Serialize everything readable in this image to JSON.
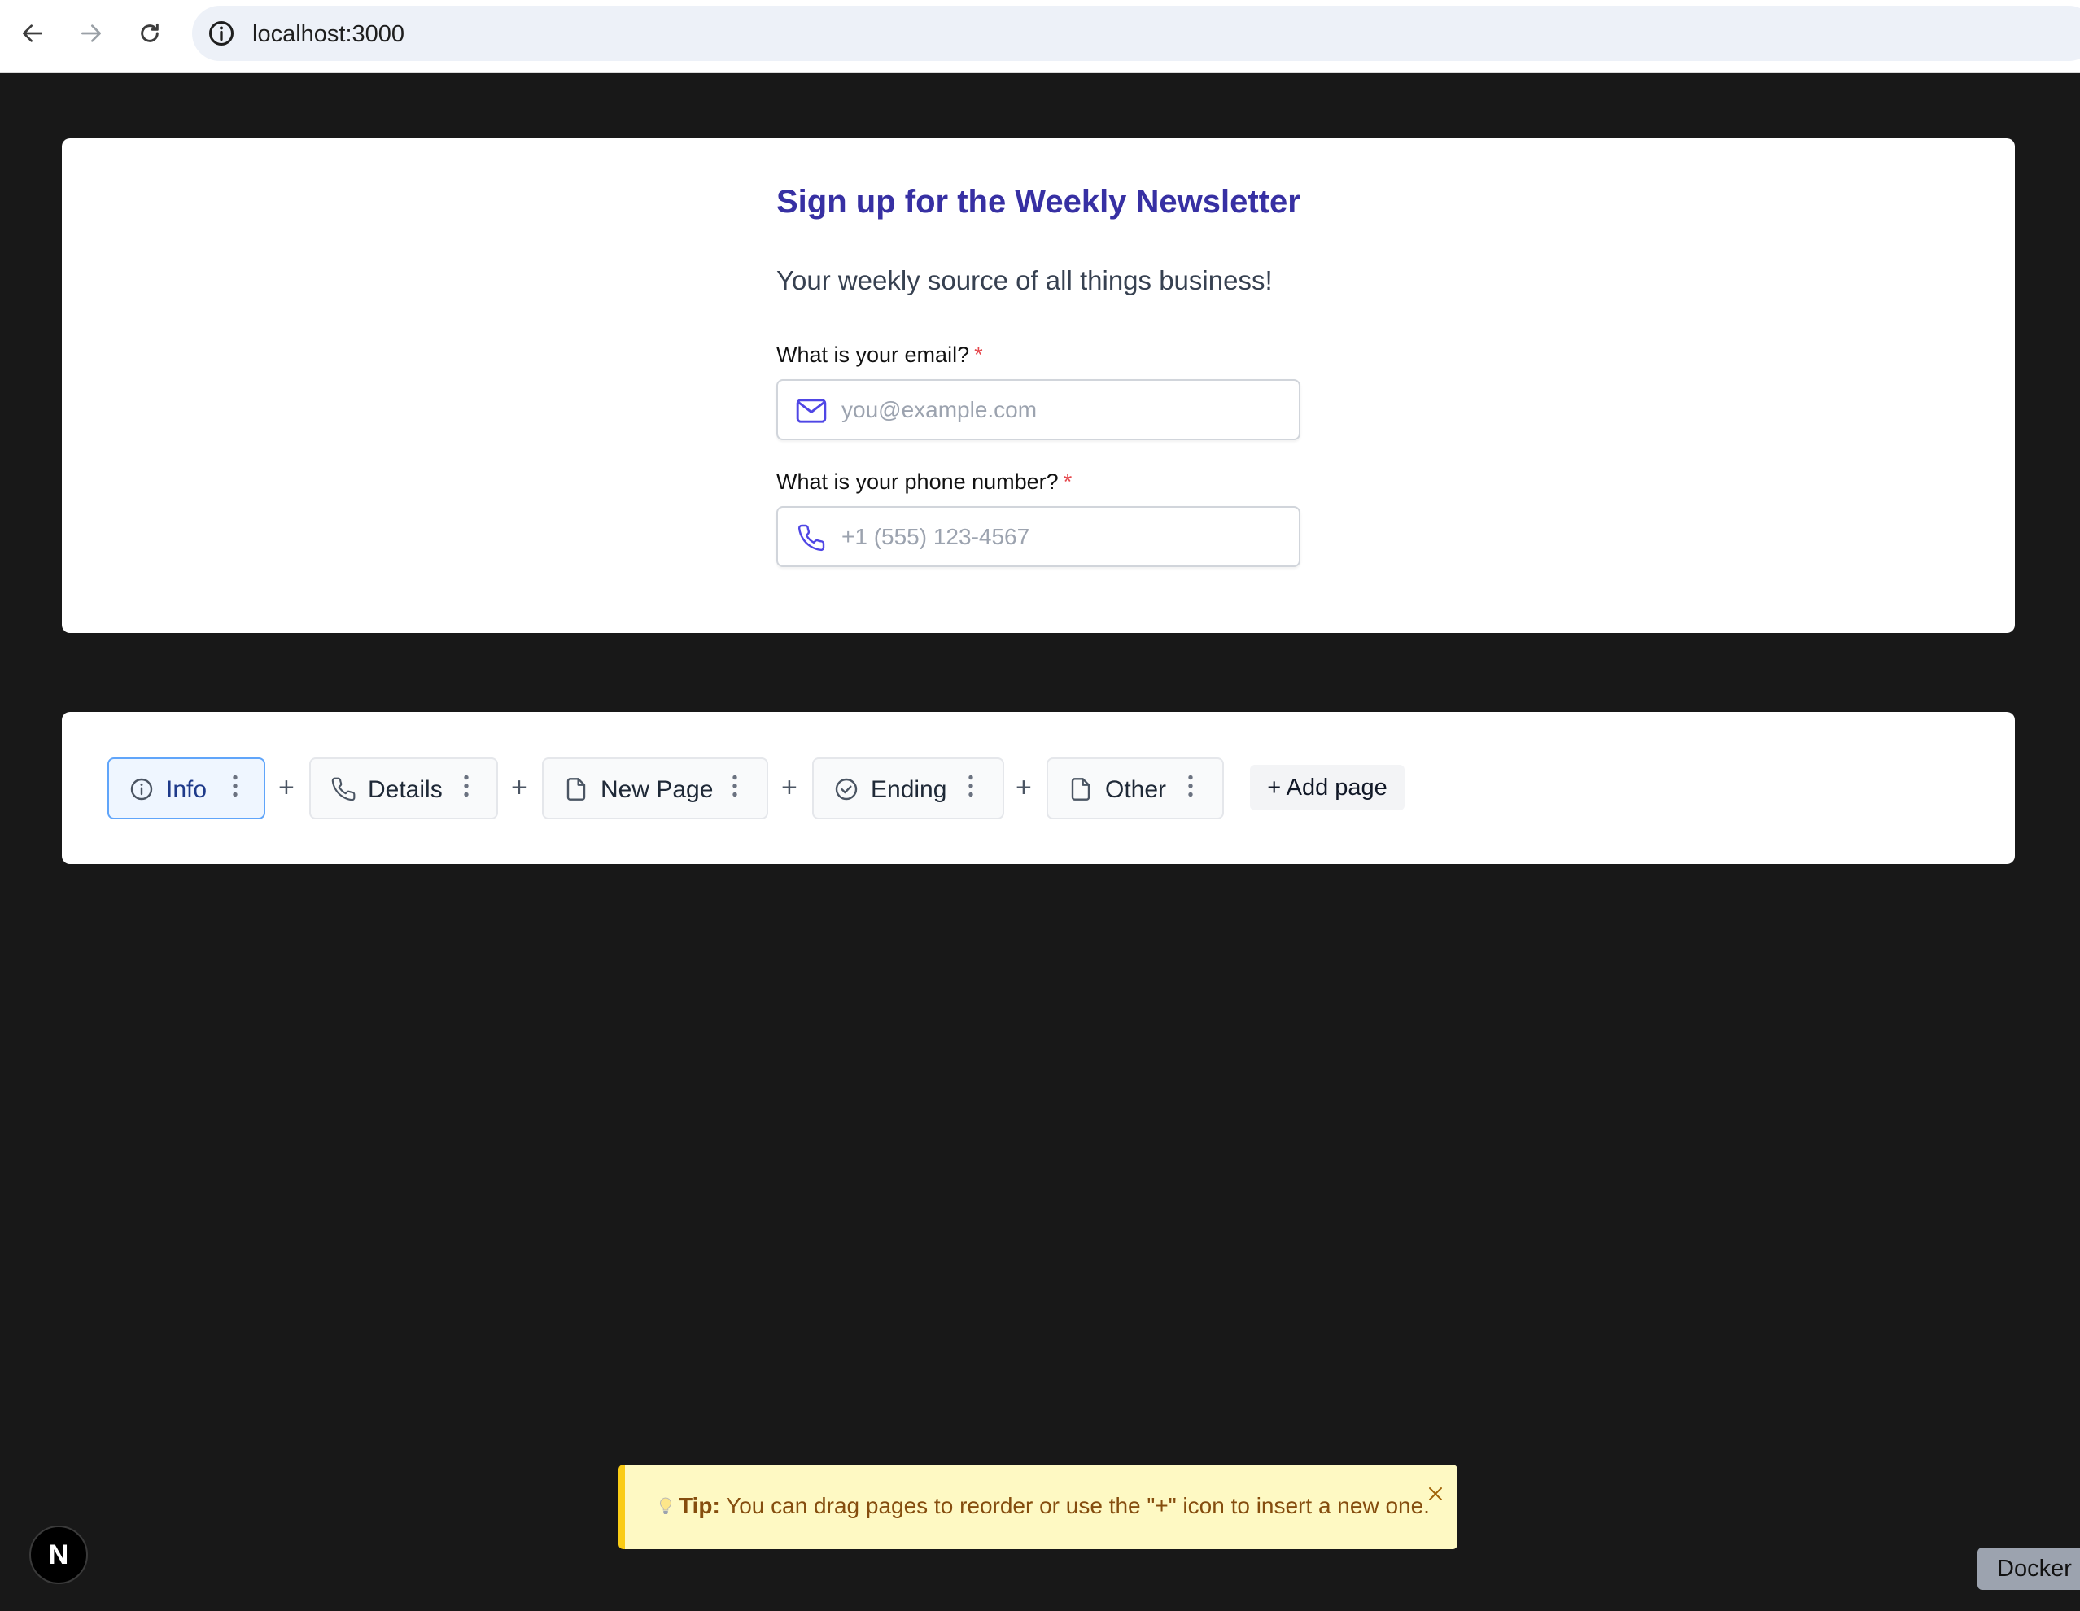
{
  "browser": {
    "url": "localhost:3000",
    "back_icon": "arrow-left-icon",
    "forward_icon": "arrow-right-icon",
    "reload_icon": "reload-icon",
    "site_info_icon": "info-icon"
  },
  "form": {
    "title": "Sign up for the Weekly Newsletter",
    "subtitle": "Your weekly source of all things business!",
    "title_color": "#3730a3",
    "fields": [
      {
        "label": "What is your email?",
        "required_mark": "*",
        "placeholder": "you@example.com",
        "value": "",
        "icon": "mail-icon"
      },
      {
        "label": "What is your phone number?",
        "required_mark": "*",
        "placeholder": "+1 (555) 123-4567",
        "value": "",
        "icon": "phone-icon"
      }
    ]
  },
  "pages": {
    "tabs": [
      {
        "label": "Info",
        "icon": "info-icon",
        "active": true
      },
      {
        "label": "Details",
        "icon": "phone-icon",
        "active": false
      },
      {
        "label": "New Page",
        "icon": "file-icon",
        "active": false
      },
      {
        "label": "Ending",
        "icon": "check-circle-icon",
        "active": false
      },
      {
        "label": "Other",
        "icon": "file-icon",
        "active": false
      }
    ],
    "insert_label": "+",
    "add_page_label": "+ Add page"
  },
  "tip": {
    "bold": "Tip:",
    "text": "You can drag pages to reorder or use the \"+\" icon to insert a new one.",
    "icon": "lightbulb-icon",
    "close_icon": "close-icon",
    "accent": "#facc15"
  },
  "next_badge": {
    "label": "N"
  },
  "docker_badge": {
    "label": "Docker"
  }
}
